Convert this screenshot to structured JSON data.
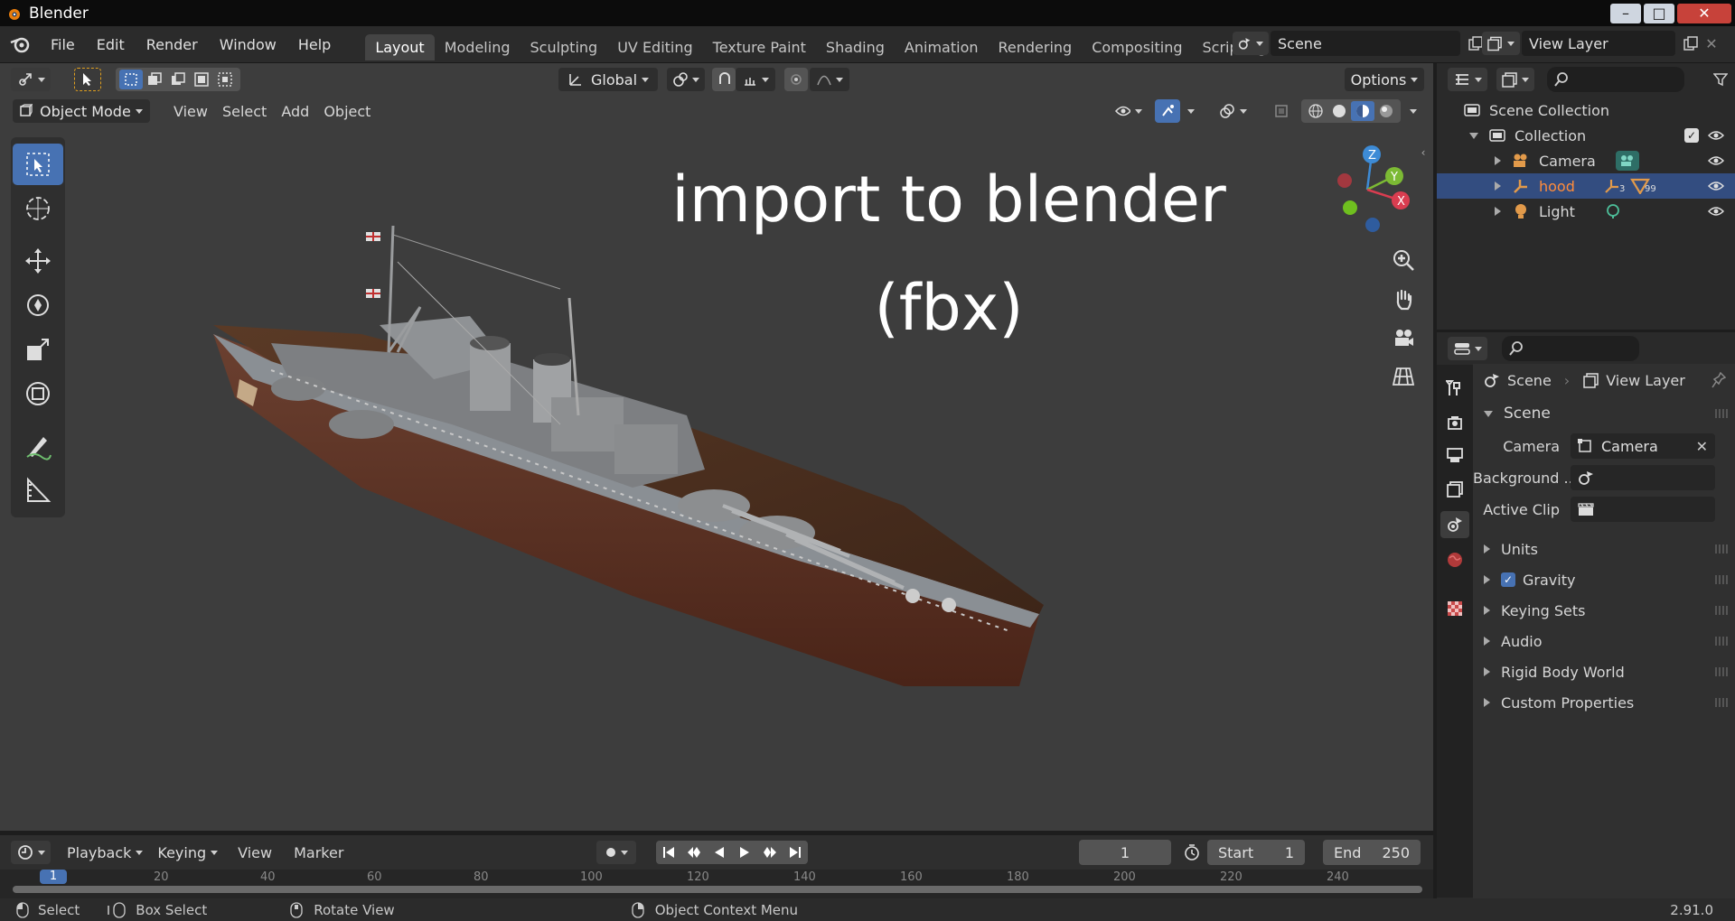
{
  "window": {
    "title": "Blender",
    "minimize": "–",
    "maximize": "□",
    "close": "✕"
  },
  "menu": [
    "File",
    "Edit",
    "Render",
    "Window",
    "Help"
  ],
  "workspaces": {
    "tabs": [
      "Layout",
      "Modeling",
      "Sculpting",
      "UV Editing",
      "Texture Paint",
      "Shading",
      "Animation",
      "Rendering",
      "Compositing",
      "Scripting"
    ],
    "active": "Layout",
    "add": "+"
  },
  "scene_selector": {
    "value": "Scene"
  },
  "viewlayer_selector": {
    "value": "View Layer"
  },
  "viewport": {
    "orientation": "Global",
    "options_label": "Options",
    "mode": "Object Mode",
    "menus": [
      "View",
      "Select",
      "Add",
      "Object"
    ],
    "overlay_line1": "import to blender",
    "overlay_line2": "(fbx)",
    "gizmo": {
      "x": "X",
      "y": "Y",
      "z": "Z"
    }
  },
  "outliner": {
    "root": "Scene Collection",
    "collection": "Collection",
    "items": [
      {
        "name": "Camera",
        "selected": false
      },
      {
        "name": "hood",
        "selected": true,
        "badge1": "3",
        "badge2": "99"
      },
      {
        "name": "Light",
        "selected": false
      }
    ]
  },
  "properties": {
    "breadcrumb_scene": "Scene",
    "breadcrumb_viewlayer": "View Layer",
    "section_scene": "Scene",
    "camera_label": "Camera",
    "camera_value": "Camera",
    "background_label": "Background ...",
    "active_clip_label": "Active Clip",
    "panels": [
      "Units",
      "Gravity",
      "Keying Sets",
      "Audio",
      "Rigid Body World",
      "Custom Properties"
    ],
    "gravity_checked": true
  },
  "timeline": {
    "menus": [
      "Playback",
      "Keying",
      "View",
      "Marker"
    ],
    "current_frame": "1",
    "start_label": "Start",
    "start_value": "1",
    "end_label": "End",
    "end_value": "250",
    "ruler": [
      "1",
      "20",
      "40",
      "60",
      "80",
      "100",
      "120",
      "140",
      "160",
      "180",
      "200",
      "220",
      "240"
    ]
  },
  "statusbar": {
    "select": "Select",
    "box_select": "Box Select",
    "rotate_view": "Rotate View",
    "context_menu": "Object Context Menu",
    "version": "2.91.0"
  },
  "colors": {
    "accent": "#4772b3",
    "selected_text": "#ff8c3b",
    "bg": "#3d3d3d"
  }
}
